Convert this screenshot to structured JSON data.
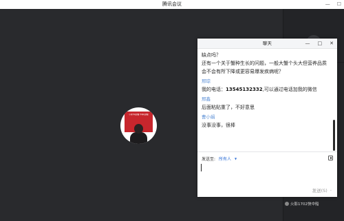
{
  "window": {
    "title": "腾讯会议",
    "minimize_label": "—",
    "maximize_label": "☐"
  },
  "stage": {
    "avatar_caption": "小孩不吃螃蟹 不再吃螃蟹"
  },
  "strip": {
    "participant_label": "火影1702快中船"
  },
  "chat": {
    "title": "聊天",
    "minimize_label": "—",
    "maximize_label": "□",
    "close_label": "✕",
    "messages": [
      {
        "sender": "",
        "text": "缺点吗？"
      },
      {
        "sender": "",
        "text": "还有一个关于蟹种生长的问题，一般大蟹个头大但营养品质会不会有所下降或更容易爆发疾病呢？"
      },
      {
        "sender": "邢琼",
        "text_prefix": "我的电话：",
        "phone": "13545132332",
        "text_suffix": ",可以通过电话加我的微信"
      },
      {
        "sender": "邢鑫",
        "text": "后面粘贴重了，不好意思"
      },
      {
        "sender": "曹小娟",
        "text": "没事没事，很棒"
      }
    ],
    "composer": {
      "send_to_label": "发送至:",
      "send_to_value": "所有人",
      "send_label": "发送(S)",
      "send_dropdown": "⌄"
    }
  }
}
